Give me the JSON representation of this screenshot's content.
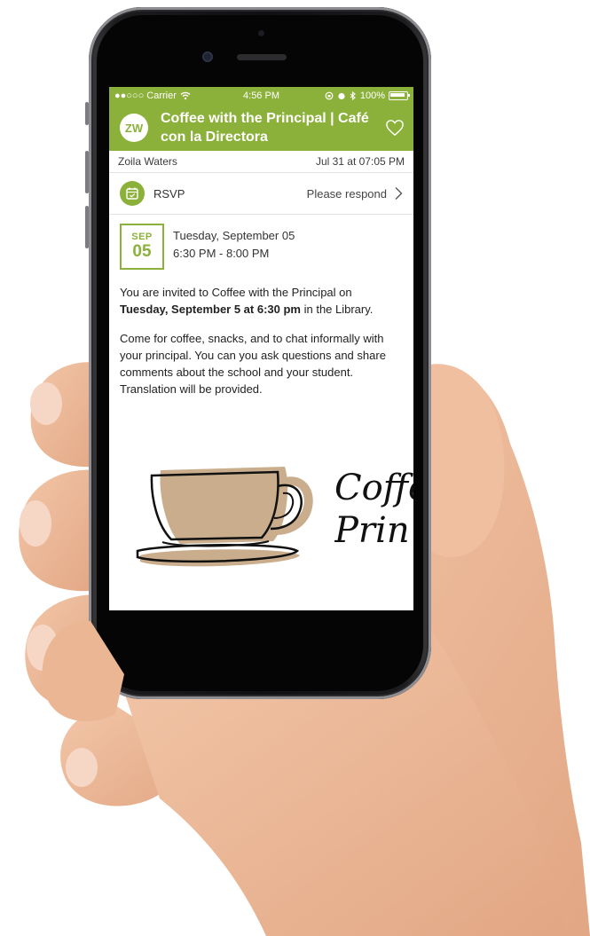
{
  "status_bar": {
    "carrier": "●●○○○ Carrier",
    "time": "4:56 PM",
    "battery": "100%"
  },
  "header": {
    "avatar_initials": "ZW",
    "title": "Coffee with the Principal | Café con la Directora"
  },
  "post": {
    "author": "Zoila Waters",
    "posted": "Jul 31 at 07:05 PM"
  },
  "rsvp": {
    "label": "RSVP",
    "status": "Please respond"
  },
  "event": {
    "month": "SEP",
    "day": "05",
    "date_line": "Tuesday, September 05",
    "time_line": "6:30 PM - 8:00 PM"
  },
  "description": {
    "p1_pre": "You are invited to Coffee with the Principal on ",
    "p1_bold": "Tuesday, September 5 at 6:30 pm",
    "p1_post": " in the Library.",
    "p2": "Come for coffee, snacks, and to chat informally with your principal. You can you ask questions and share comments about the school and your student. Translation will be provided."
  },
  "flyer": {
    "line1": "Coffe",
    "line2": "Prin"
  },
  "colors": {
    "brand_green": "#8bb13a",
    "cup_tan": "#c9ad8c"
  }
}
